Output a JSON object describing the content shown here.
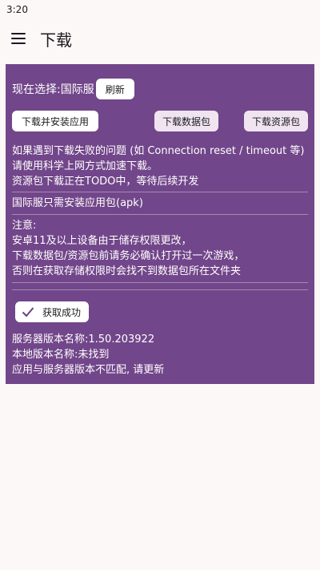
{
  "status_bar": {
    "time": "3:20"
  },
  "app_bar": {
    "title": "下载",
    "menu_icon": "menu-icon"
  },
  "region": {
    "label": "现在选择:国际服",
    "refresh_button": "刷新"
  },
  "actions": {
    "install_app": "下载并安装应用",
    "download_data": "下载数据包",
    "download_resources": "下载资源包"
  },
  "info": {
    "line1": "如果遇到下载失败的问题 (如 Connection reset / timeout 等)",
    "line2": "请使用科学上网方式加速下载。",
    "line3": "资源包下载正在TODO中，等待后续开发"
  },
  "global_note": "国际服只需安装应用包(apk)",
  "notice": {
    "title": "注意:",
    "line1": "安卓11及以上设备由于储存权限更改，",
    "line2": "下载数据包/资源包前请务必确认打开过一次游戏，",
    "line3": "否则在获取存储权限时会找不到数据包所在文件夹"
  },
  "permission": {
    "label": "获取成功",
    "icon": "check-icon"
  },
  "versions": {
    "server": "服务器版本名称:1.50.203922",
    "local": "本地版本名称:未找到",
    "mismatch": "应用与服务器版本不匹配, 请更新"
  },
  "colors": {
    "panel": "#72468a",
    "background": "#fdf8f8",
    "button_tonal": "#f0e4f0"
  }
}
